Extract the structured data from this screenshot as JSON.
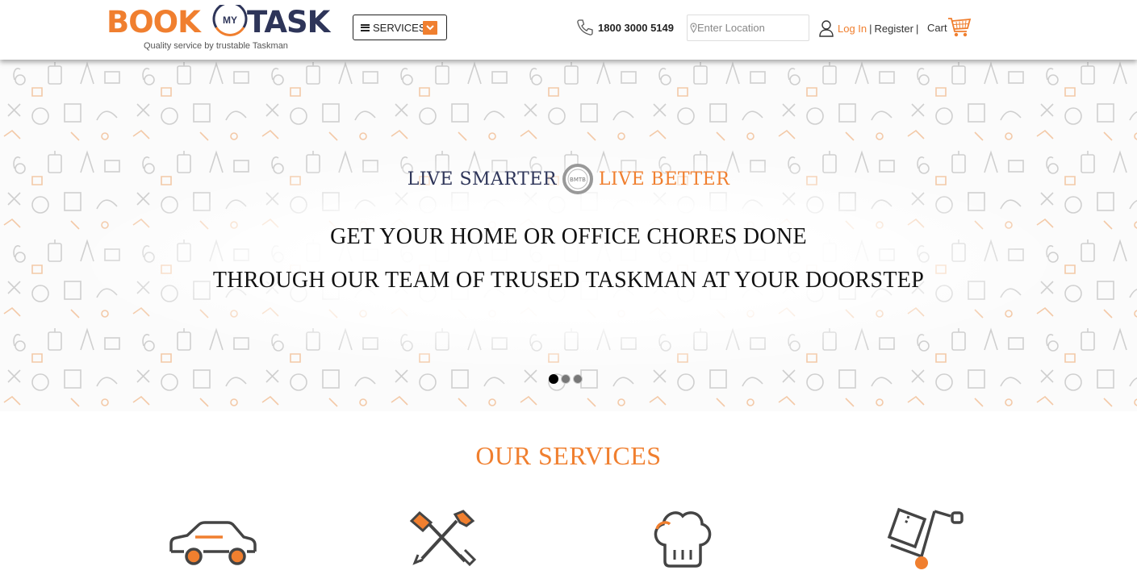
{
  "header": {
    "logo": {
      "book": "BOOK",
      "my": "MY",
      "task": "TASK",
      "tagline": "Quality service by trustable Taskman"
    },
    "services_button": "SERVICES",
    "phone": "1800 3000 5149",
    "location_placeholder": "Enter Location",
    "login": "Log In",
    "separator": "|",
    "register": "Register",
    "separator2": "|",
    "cart": "Cart"
  },
  "hero": {
    "tagline_left": "LIVE SMARTER",
    "badge": "BMTB",
    "tagline_right": "LIVE BETTER",
    "line1": "GET YOUR HOME OR OFFICE CHORES  DONE",
    "line2": "THROUGH OUR TEAM OF TRUSED TASKMAN AT YOUR DOORSTEP",
    "slides": 3,
    "active_slide": 1
  },
  "services": {
    "title": "OUR SERVICES",
    "icons": [
      "car-icon",
      "tools-icon",
      "chef-hat-icon",
      "hand-truck-icon"
    ]
  },
  "colors": {
    "brand_orange": "#f07f2f",
    "brand_navy": "#2e3559"
  }
}
